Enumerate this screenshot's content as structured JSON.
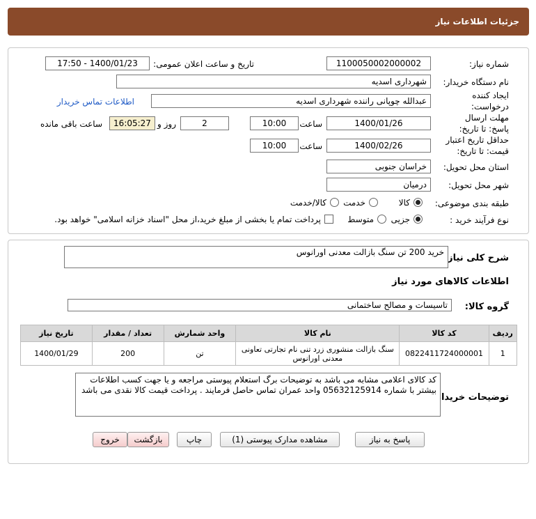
{
  "header": {
    "title": "جزئیات اطلاعات نیاز"
  },
  "info": {
    "need_number_label": "شماره نیاز:",
    "need_number": "1100050002000002",
    "announce_label": "تاریخ و ساعت اعلان عمومی:",
    "announce_value": "1400/01/23 - 17:50",
    "buyer_label": "نام دستگاه خریدار:",
    "buyer_value": "شهرداری اسدیه",
    "creator_label": "ایجاد کننده درخواست:",
    "creator_value": "عبدالله چوپانی راننده شهرداری اسدیه",
    "contact_link": "اطلاعات تماس خریدار",
    "deadline_label": "مهلت ارسال پاسخ: تا تاریخ:",
    "deadline_date": "1400/01/26",
    "time_label": "ساعت",
    "deadline_time": "10:00",
    "days_value": "2",
    "days_label": "روز و",
    "remaining_time": "16:05:27",
    "remaining_label": "ساعت باقی مانده",
    "validity_label": "حداقل تاریخ اعتبار قیمت: تا تاریخ:",
    "validity_date": "1400/02/26",
    "validity_time": "10:00",
    "province_label": "استان محل تحویل:",
    "province_value": "خراسان جنوبی",
    "city_label": "شهر محل تحویل:",
    "city_value": "درمیان",
    "category_label": "طبقه بندی موضوعی:",
    "category_options": [
      "کالا",
      "خدمت",
      "کالا/خدمت"
    ],
    "process_label": "نوع فرآیند خرید :",
    "process_options": [
      "جزیی",
      "متوسط"
    ],
    "payment_note": "پرداخت تمام یا بخشی از مبلغ خرید،از محل \"اسناد خزانه اسلامی\" خواهد بود."
  },
  "details": {
    "summary_label": "شرح کلی نیاز:",
    "summary_value": "خرید 200 تن سنگ بازالت معدنی اورانوس",
    "items_title": "اطلاعات کالاهای مورد نیاز",
    "group_label": "گروه کالا:",
    "group_value": "تاسیسات و مصالح ساختمانی",
    "table_headers": [
      "ردیف",
      "کد کالا",
      "نام کالا",
      "واحد شمارش",
      "تعداد / مقدار",
      "تاریخ نیاز"
    ],
    "rows": [
      [
        "1",
        "0822411724000001",
        "سنگ بازالت منشوری زرد تنی نام تجارتی تعاونی معدنی اورانوس",
        "تن",
        "200",
        "1400/01/29"
      ]
    ],
    "desc_label": "توضیحات خریدار:",
    "desc_value": "کد کالای اعلامی مشابه می باشد به توضیحات برگ استعلام پیوستی مراجعه و یا جهت کسب اطلاعات بیشتر با شماره 05632125914 واحد عمران تماس حاصل فرمایند .  پرداخت قیمت کالا نقدی می باشد"
  },
  "buttons": {
    "reply": "پاسخ به نیاز",
    "attachments": "مشاهده مدارک پیوستی (1)",
    "print": "چاپ",
    "back": "بازگشت",
    "exit": "خروج"
  }
}
